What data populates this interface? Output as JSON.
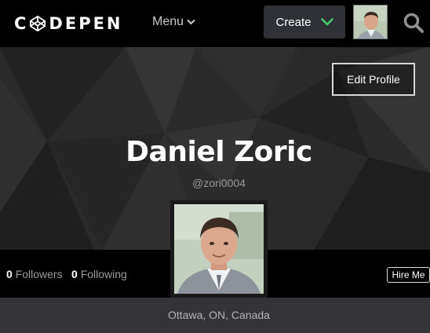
{
  "nav": {
    "logo_first": "C",
    "logo_rest": "DEPEN",
    "menu_label": "Menu",
    "create_label": "Create",
    "icons": {
      "logo": "codepen-cube-icon",
      "menu_chevron": "chevron-down-icon",
      "create_chevron": "chevron-down-icon",
      "search": "search-icon"
    },
    "accent_color": "#47cf73"
  },
  "profile": {
    "edit_label": "Edit Profile",
    "name": "Daniel Zoric",
    "handle": "@zori0004",
    "location": "Ottawa, ON, Canada"
  },
  "stats": {
    "followers_count": "0",
    "followers_label": "Followers",
    "following_count": "0",
    "following_label": "Following",
    "hire_label": "Hire Me"
  }
}
